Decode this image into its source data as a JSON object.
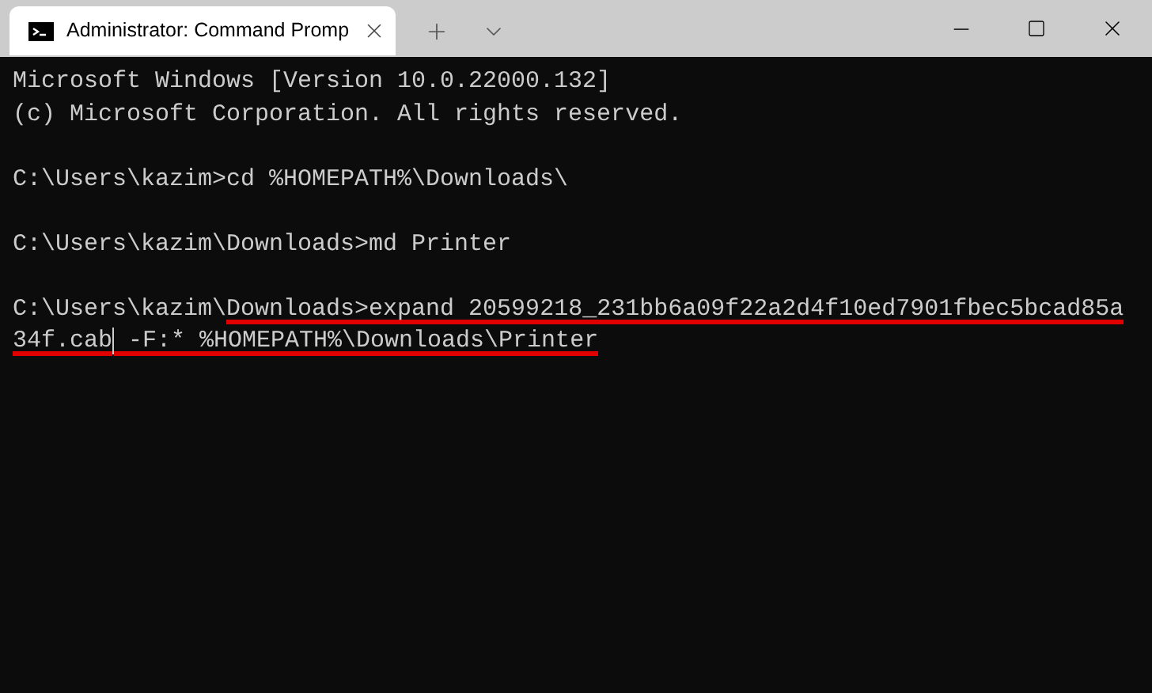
{
  "tab": {
    "title": "Administrator: Command Promp",
    "selected": true
  },
  "terminal": {
    "blocks": [
      {
        "lines": [
          {
            "segments": [
              {
                "kind": "text",
                "text": "Microsoft Windows [Version 10.0.22000.132]",
                "underlined": false
              }
            ]
          },
          {
            "segments": [
              {
                "kind": "text",
                "text": "(c) Microsoft Corporation. All rights reserved.",
                "underlined": false
              }
            ]
          }
        ]
      },
      {
        "lines": [
          {
            "segments": [
              {
                "kind": "text",
                "text": "C:\\Users\\kazim>cd %HOMEPATH%\\Downloads\\",
                "underlined": false
              }
            ]
          }
        ]
      },
      {
        "lines": [
          {
            "segments": [
              {
                "kind": "text",
                "text": "C:\\Users\\kazim\\Downloads>md Printer",
                "underlined": false
              }
            ]
          }
        ]
      },
      {
        "lines": [
          {
            "segments": [
              {
                "kind": "text",
                "text": "C:\\Users\\kazim\\",
                "underlined": false
              },
              {
                "kind": "text",
                "text": "Downloads>expand 20599218_231bb6a09f22a2d4f10ed7901fbec5bcad85a",
                "underlined": true
              }
            ]
          },
          {
            "segments": [
              {
                "kind": "text",
                "text": "34f.cab",
                "underlined": true
              },
              {
                "kind": "cursor"
              },
              {
                "kind": "text",
                "text": " -F:* %HOMEPATH%\\Downloads\\Printer",
                "underlined": true
              }
            ]
          }
        ]
      }
    ]
  }
}
